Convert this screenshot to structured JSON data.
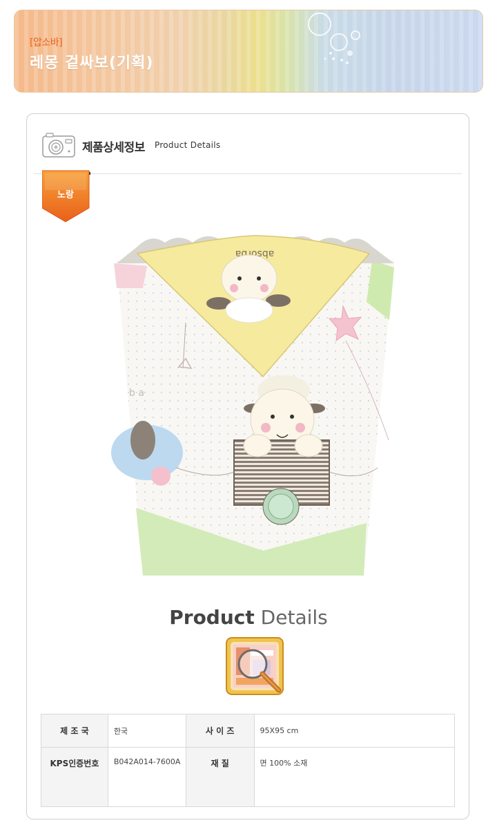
{
  "banner": {
    "subtitle": "[압소바]",
    "title": "레몽 겉싸보(기획)"
  },
  "section": {
    "title_ko": "제품상세정보",
    "title_en": "Product Details"
  },
  "color_tag": {
    "label": "노랑",
    "color": "#f07a1a"
  },
  "product_image": {
    "brand_text": "absorba",
    "letters": "b a"
  },
  "product_details_heading": {
    "strong": "Product",
    "light": "Details"
  },
  "spec": {
    "rows": [
      {
        "label1": "제 조 국",
        "value1": "한국",
        "label2": "사 이 즈",
        "value2": "95X95 cm"
      },
      {
        "label1": "KPS인증번호",
        "value1": "B042A014-7600A",
        "label2": "재       질",
        "value2": "면 100% 소재"
      }
    ]
  },
  "colors": {
    "accent": "#e8621e",
    "border": "#d9d9d9",
    "header_bg": "#f4f4f4"
  }
}
